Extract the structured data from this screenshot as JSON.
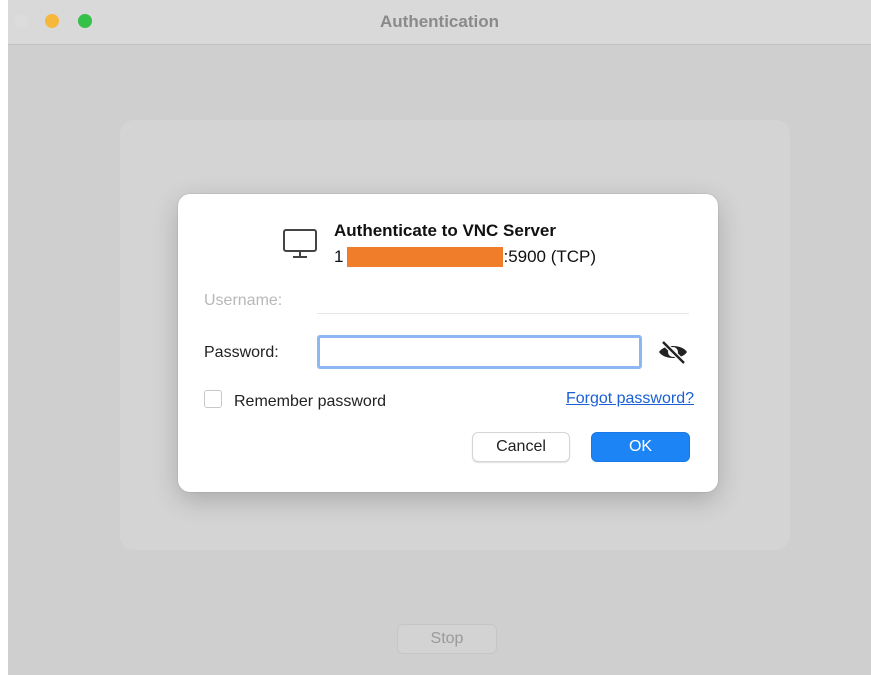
{
  "window": {
    "title": "Authentication"
  },
  "dialog": {
    "title": "Authenticate to VNC Server",
    "server_prefix": "1",
    "server_suffix": ":5900 (TCP)",
    "server_redaction_color": "#ef7d2a",
    "icon": "monitor-icon"
  },
  "form": {
    "username_label": "Username:",
    "username_value": "",
    "password_label": "Password:",
    "password_value": "",
    "password_toggle_icon": "eye-slash-icon",
    "remember_label": "Remember password",
    "remember_checked": false,
    "forgot_link": "Forgot password?"
  },
  "buttons": {
    "cancel": "Cancel",
    "ok": "OK",
    "stop": "Stop"
  },
  "colors": {
    "accent": "#1d84f5",
    "link": "#1a5fd6",
    "focus_ring": "#8db7f3",
    "traffic_minimize": "#f5b83d",
    "traffic_zoom": "#35c048"
  }
}
